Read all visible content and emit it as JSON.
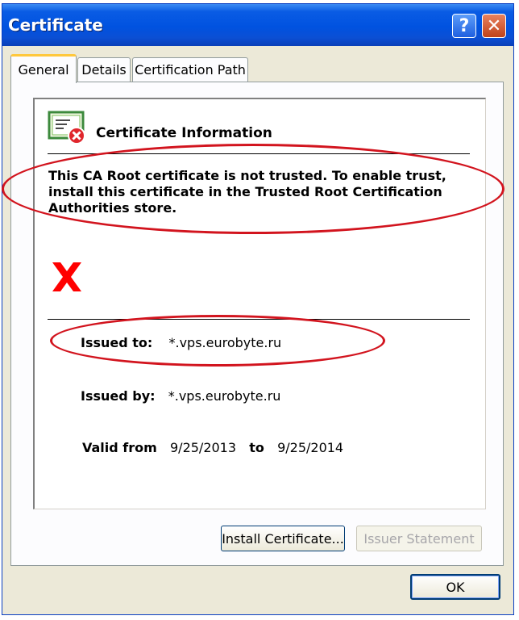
{
  "window": {
    "title": "Certificate"
  },
  "titlebar": {
    "help_glyph": "?",
    "close_glyph": "✕"
  },
  "tabs": [
    {
      "label": "General",
      "active": true
    },
    {
      "label": "Details",
      "active": false
    },
    {
      "label": "Certification Path",
      "active": false
    }
  ],
  "info": {
    "heading": "Certificate Information",
    "warning_lines": [
      "This CA Root certificate is not trusted. To enable trust,",
      "install this certificate in the Trusted Root Certification",
      "Authorities store."
    ]
  },
  "fields": {
    "issued_to_label": "Issued to:",
    "issued_to_value": "*.vps.eurobyte.ru",
    "issued_by_label": "Issued by:",
    "issued_by_value": "*.vps.eurobyte.ru",
    "valid_from_label": "Valid from",
    "valid_from_value": "9/25/2013",
    "valid_to_label": "to",
    "valid_to_value": "9/25/2014"
  },
  "buttons": {
    "install": "Install Certificate...",
    "issuer": "Issuer Statement",
    "ok": "OK"
  },
  "colors": {
    "accent_blue": "#0052e0",
    "annotation_red": "#d2141e",
    "dialog_bg": "#ece9d8"
  },
  "icons": [
    "certificate-error-icon",
    "help-icon",
    "close-icon",
    "red-x-icon"
  ]
}
